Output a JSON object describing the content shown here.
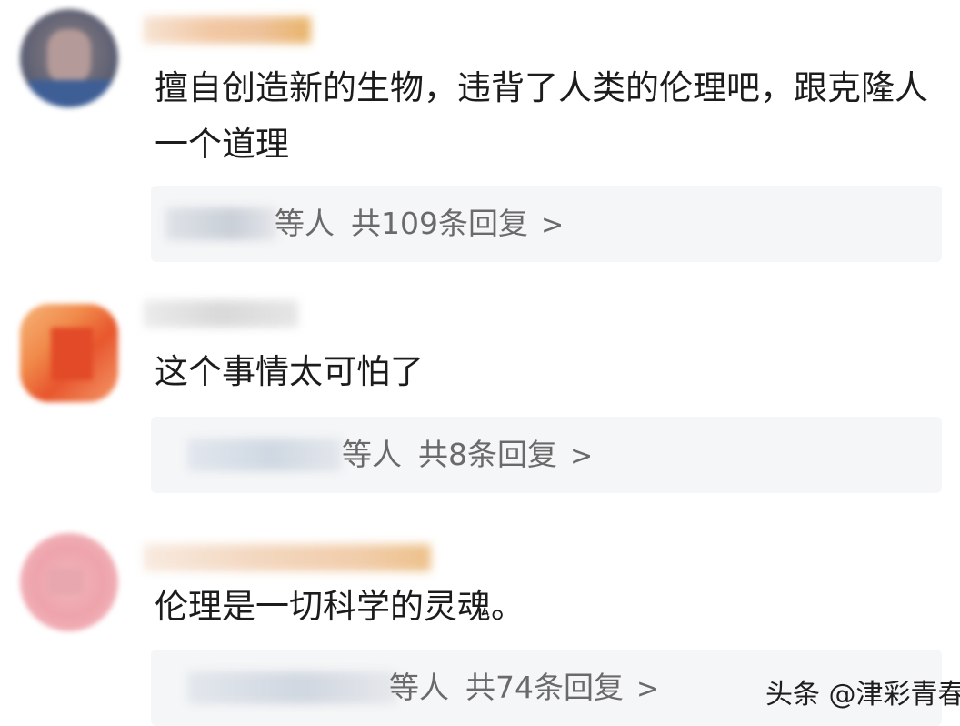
{
  "comments": [
    {
      "text": "擅自创造新的生物，违背了人类的伦理吧，跟克隆人一个道理",
      "reply_suffix": "等人",
      "reply_count": "共109条回复",
      "chevron": ">"
    },
    {
      "text": "这个事情太可怕了",
      "reply_suffix": "等人",
      "reply_count": "共8条回复",
      "chevron": ">"
    },
    {
      "text": "伦理是一切科学的灵魂。",
      "reply_suffix": "等人",
      "reply_count": "共74条回复",
      "chevron": ">"
    }
  ],
  "watermark": "头条 @津彩青春"
}
